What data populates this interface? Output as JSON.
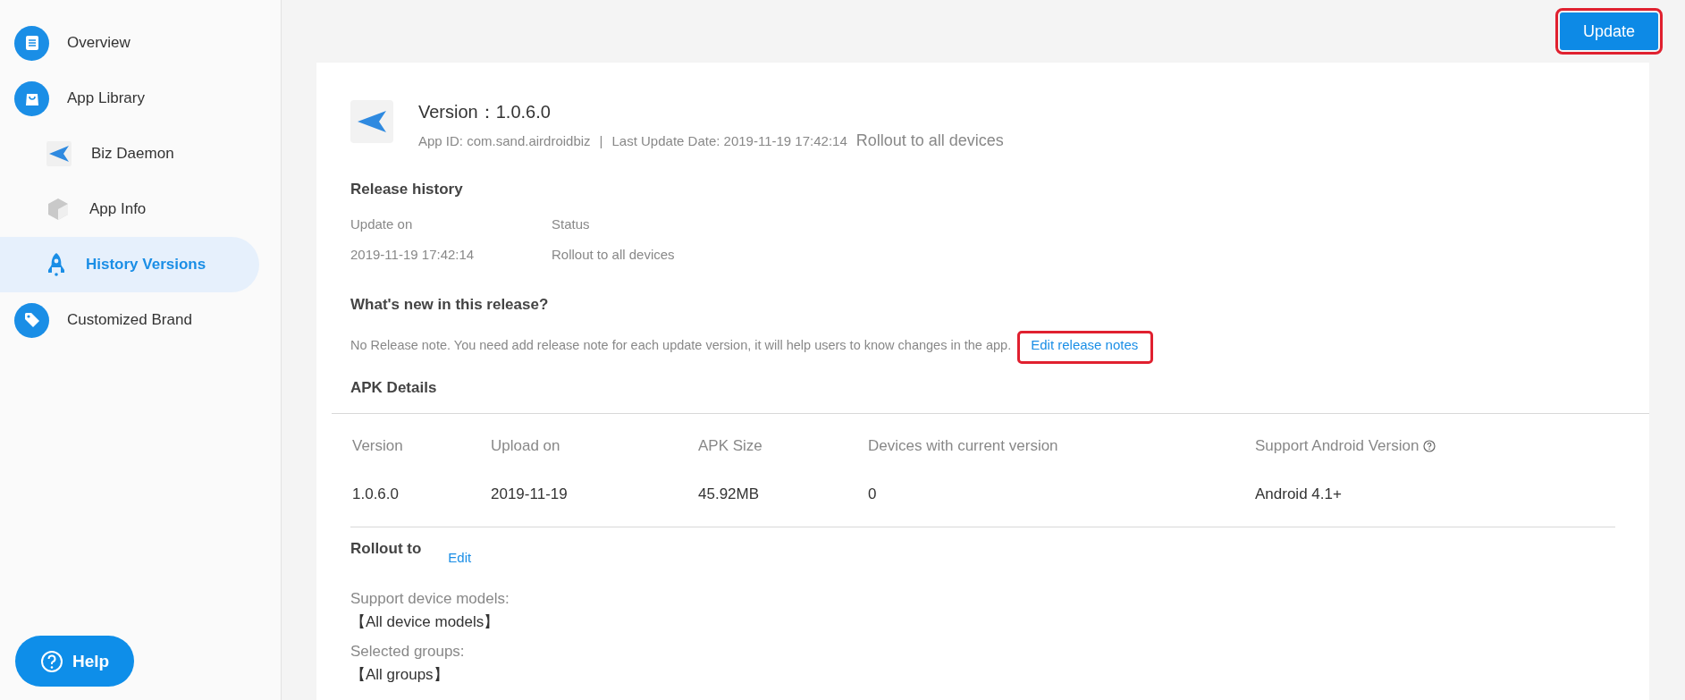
{
  "sidebar": {
    "items": [
      {
        "kind": "top",
        "label": "Overview",
        "selected": false
      },
      {
        "kind": "top",
        "label": "App Library",
        "selected": false
      },
      {
        "kind": "sub",
        "label": "Biz Daemon",
        "selected": false
      },
      {
        "kind": "sub",
        "label": "App Info",
        "selected": false
      },
      {
        "kind": "sub",
        "label": "History Versions",
        "selected": true
      },
      {
        "kind": "top",
        "label": "Customized Brand",
        "selected": false
      }
    ],
    "help_button": "Help"
  },
  "toolbar": {
    "update_button": {
      "label": "Update",
      "highlighted": true
    }
  },
  "header": {
    "version": "Version：1.0.6.0",
    "app_id": "App ID: com.sand.airdroidbiz",
    "separator": "|",
    "last_update": "Last Update Date: 2019-11-19 17:42:14",
    "rollout": "Rollout to all devices"
  },
  "release_history": {
    "title": "Release history",
    "columns": [
      "Update on",
      "Status"
    ],
    "row": [
      "2019-11-19 17:42:14",
      "Rollout to all devices"
    ]
  },
  "whats_new": {
    "title": "What's new in this release?",
    "note": "No Release note. You need add release note for each update version, it will help users to know changes in the app.",
    "edit_link": {
      "label": "Edit release notes",
      "highlighted": true
    }
  },
  "apk_details": {
    "title": "APK Details",
    "columns": [
      "Version",
      "Upload on",
      "APK Size",
      "Devices with current version",
      "Support Android Version"
    ],
    "row": [
      "1.0.6.0",
      "2019-11-19",
      "45.92MB",
      "0",
      "Android 4.1+"
    ]
  },
  "rollout": {
    "title": "Rollout to",
    "edit_link": "Edit",
    "fields": [
      {
        "label": "Support device models:",
        "value": "【All device models】"
      },
      {
        "label": "Selected groups:",
        "value": "【All groups】"
      }
    ]
  }
}
